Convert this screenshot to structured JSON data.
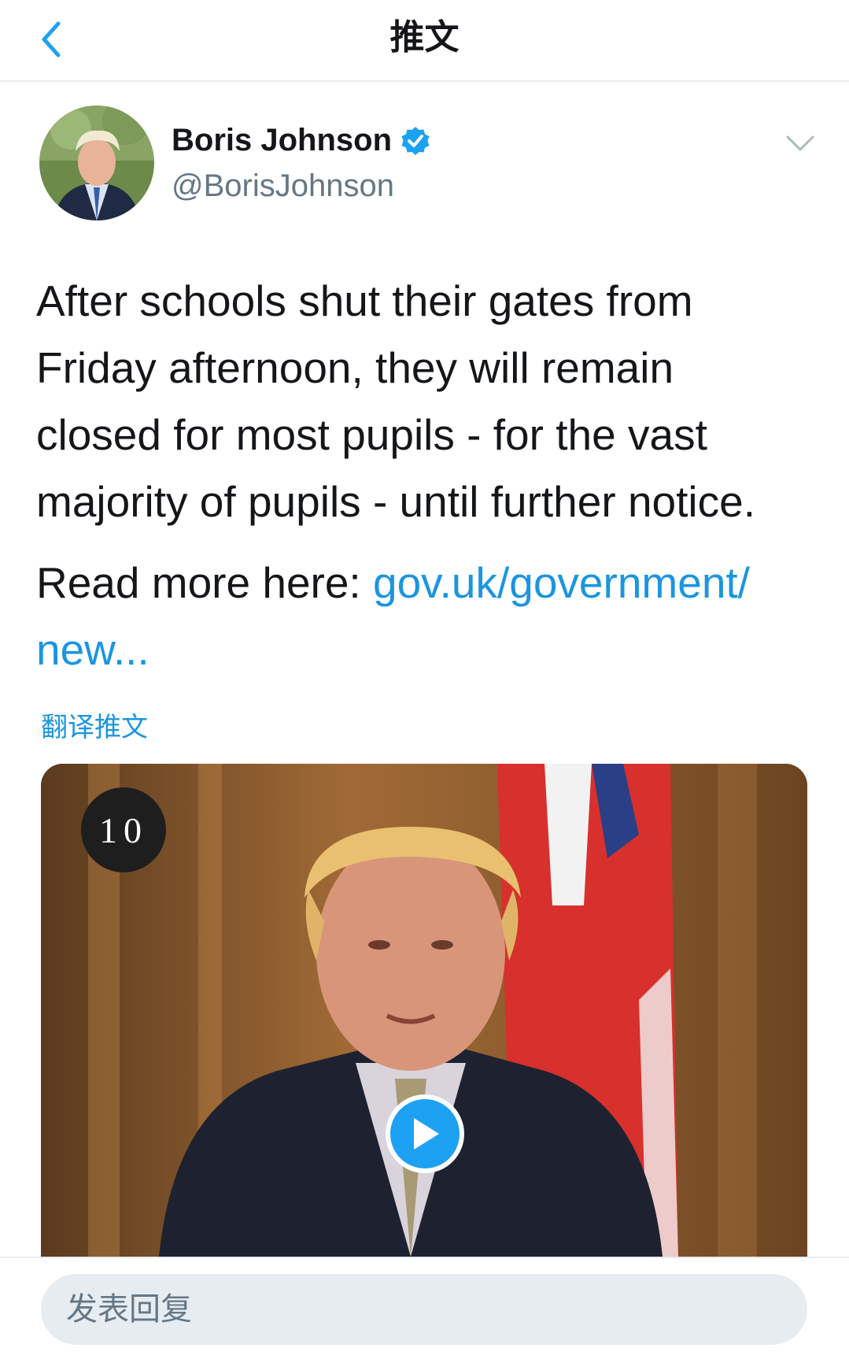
{
  "header": {
    "title": "推文"
  },
  "tweet": {
    "author": {
      "display_name": "Boris Johnson",
      "handle": "@BorisJohnson",
      "verified": true
    },
    "text_lines": [
      "After schools shut their gates from",
      "Friday afternoon, they will remain",
      "closed for most pupils - for the vast",
      "majority of pupils - until further notice."
    ],
    "read_more_prefix": "Read more here: ",
    "link_line1": "gov.uk/government/",
    "link_line2": "new...",
    "translate_label": "翻译推文",
    "media": {
      "logo_text": "10",
      "type": "video"
    }
  },
  "reply": {
    "placeholder": "发表回复"
  },
  "colors": {
    "accent": "#1b95e0",
    "verified": "#1da1f2",
    "secondary_text": "#657786",
    "divider": "#e6ecf0"
  },
  "icons": {
    "back": "chevron-left-icon",
    "verified": "verified-badge-icon",
    "more": "chevron-down-icon",
    "play": "play-icon"
  }
}
